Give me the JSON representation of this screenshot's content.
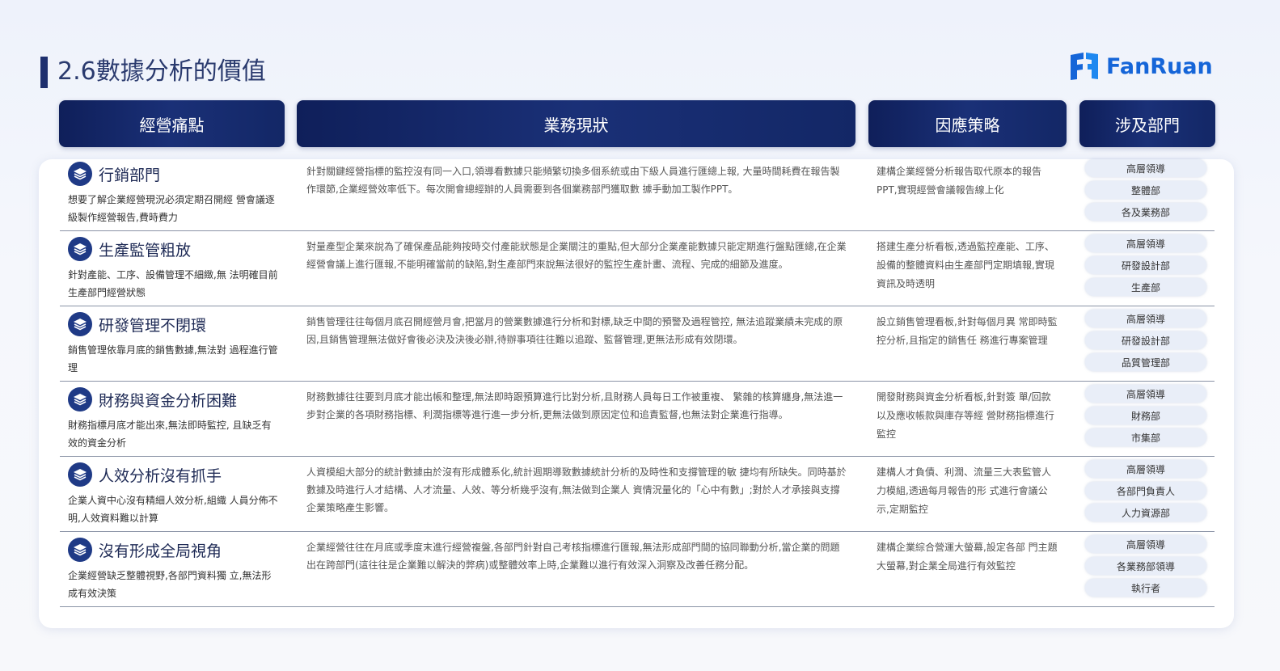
{
  "page": {
    "title": "2.6數據分析的價值",
    "brand": "FanRuan"
  },
  "headers": {
    "pain": "經營痛點",
    "status": "業務現狀",
    "strategy": "因應策略",
    "dept": "涉及部門"
  },
  "rows": [
    {
      "pain_title": "行銷部門",
      "pain_desc": "想要了解企業經營現況必須定期召開經 營會議逐級製作經營報告,費時費力",
      "status": "針對關鍵經營指標的監控沒有同一入口,領導看數據只能頻繁切換多個系統或由下級人員進行匯總上報, 大量時間耗費在報告製作環節,企業經營效率低下。每次開會總經辦的人員需要到各個業務部門獲取數 據手動加工製作PPT。",
      "strategy": "建構企業經營分析報告取代原本的報告PPT,實現經營會議報告線上化",
      "depts": [
        "高層領導",
        "整體部",
        "各及業務部"
      ]
    },
    {
      "pain_title": "生產監管粗放",
      "pain_desc": "針對產能、工序、設備管理不細緻,無 法明確目前生產部門經營狀態",
      "status": "對量產型企業來說為了確保產品能夠按時交付產能狀態是企業關注的重點,但大部分企業產能數據只能定期進行盤點匯總,在企業經營會議上進行匯報,不能明確當前的缺陷,對生產部門來說無法很好的監控生產計畫、流程、完成的細節及進度。",
      "strategy": "搭建生產分析看板,透過監控產能、工序、設備的整體資料由生產部門定期填報,實現資訊及時透明",
      "depts": [
        "高層領導",
        "研發設計部",
        "生產部"
      ]
    },
    {
      "pain_title": "研發管理不閉環",
      "pain_desc": "銷售管理依靠月底的銷售數據,無法對 過程進行管理",
      "status": "銷售管理往往每個月底召開經營月會,把當月的營業數據進行分析和對標,缺乏中間的預警及過程管控, 無法追蹤業績未完成的原因,且銷售管理無法做好會後必決及決後必辦,待辦事項往往難以追蹤、監督管理,更無法形成有效閉環。",
      "strategy": "設立銷售管理看板,針對每個月異 常即時監控分析,且指定的銷售任 務進行專案管理",
      "depts": [
        "高層領導",
        "研發設計部",
        "品質管理部"
      ]
    },
    {
      "pain_title": "財務與資金分析困難",
      "pain_desc": "財務指標月底才能出來,無法即時監控, 且缺乏有效的資金分析",
      "status": "財務數據往往要到月底才能出帳和整理,無法即時跟預算進行比對分析,且財務人員每日工作被重複、 繁雜的核算纏身,無法進一步對企業的各項財務指標、利潤指標等進行進一步分析,更無法做到原因定位和追責監督,也無法對企業進行指導。",
      "strategy": "開發財務與資金分析看板,針對簽 單/回款以及應收帳款與庫存等經 營財務指標進行監控",
      "depts": [
        "高層領導",
        "財務部",
        "市集部"
      ]
    },
    {
      "pain_title": "人效分析沒有抓手",
      "pain_desc": "企業人資中心沒有精細人效分析,組織 人員分佈不明,人效資料難以計算",
      "status": "人資模組大部分的統計數據由於沒有形成體系化,統計週期導致數據統計分析的及時性和支撐管理的敏 捷均有所缺失。同時基於數據及時進行人才結構、人才流量、人效、等分析幾乎沒有,無法做到企業人 資情況量化的「心中有數」;對於人才承接與支撐企業策略產生影響。",
      "strategy": "建構人才負債、利潤、流量三大表監管人力模組,透過每月報告的形 式進行會議公示,定期監控",
      "depts": [
        "高層領導",
        "各部門負責人",
        "人力資源部"
      ]
    },
    {
      "pain_title": "沒有形成全局視角",
      "pain_desc": "企業經營缺乏整體視野,各部門資料獨 立,無法形成有效決策",
      "status": "企業經營往往在月底或季度末進行經營複盤,各部門針對自己考核指標進行匯報,無法形成部門間的協同聯動分析,當企業的問題出在跨部門(這往往是企業難以解決的弊病)或整體效率上時,企業難以進行有效深入洞察及改善任務分配。",
      "strategy": "建構企業綜合營運大螢幕,設定各部 門主題大螢幕,對企業全局進行有效監控",
      "depts": [
        "高層領導",
        "各業務部領導",
        "執行者"
      ]
    }
  ]
}
